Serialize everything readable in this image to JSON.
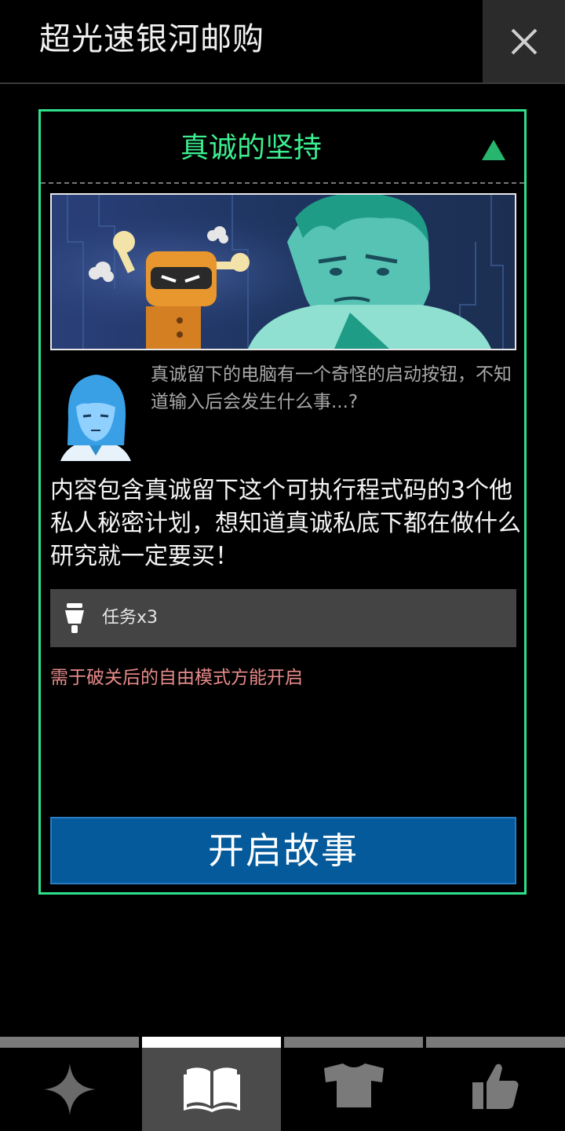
{
  "header": {
    "title": "超光速银河邮购"
  },
  "card": {
    "title": "真诚的坚持",
    "quote": "真诚留下的电脑有一个奇怪的启动按钮，不知道输入后会发生什么事...?",
    "description": "内容包含真诚留下这个可执行程式码的3个他私人秘密计划，想知道真诚私底下都在做什么研究就一定要买！",
    "reward_label": "任务x3",
    "requirement": "需于破关后的自由模式方能开启",
    "start_button": "开启故事"
  },
  "colors": {
    "accent_green": "#2ee08a",
    "button_blue": "#045a9b",
    "warning_pink": "#e88a8a"
  },
  "nav": {
    "tabs": [
      {
        "icon": "star-icon",
        "active": false
      },
      {
        "icon": "book-icon",
        "active": true
      },
      {
        "icon": "shirt-icon",
        "active": false
      },
      {
        "icon": "thumbs-up-icon",
        "active": false
      }
    ]
  }
}
